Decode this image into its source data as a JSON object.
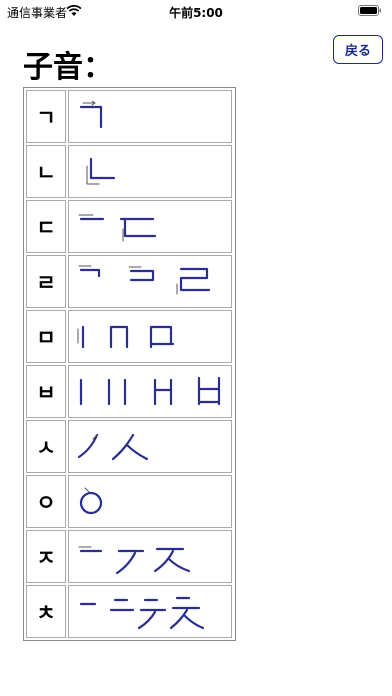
{
  "status_bar": {
    "carrier": "通信事業者",
    "time": "午前5:00"
  },
  "header": {
    "title": "子音：",
    "back_label": "戻る"
  },
  "consonants": [
    {
      "letter": "ㄱ"
    },
    {
      "letter": "ㄴ"
    },
    {
      "letter": "ㄷ"
    },
    {
      "letter": "ㄹ"
    },
    {
      "letter": "ㅁ"
    },
    {
      "letter": "ㅂ"
    },
    {
      "letter": "ㅅ"
    },
    {
      "letter": "ㅇ"
    },
    {
      "letter": "ㅈ"
    },
    {
      "letter": "ㅊ"
    }
  ],
  "colors": {
    "stroke": "#2a2f8f",
    "button": "#1b2a8a"
  }
}
